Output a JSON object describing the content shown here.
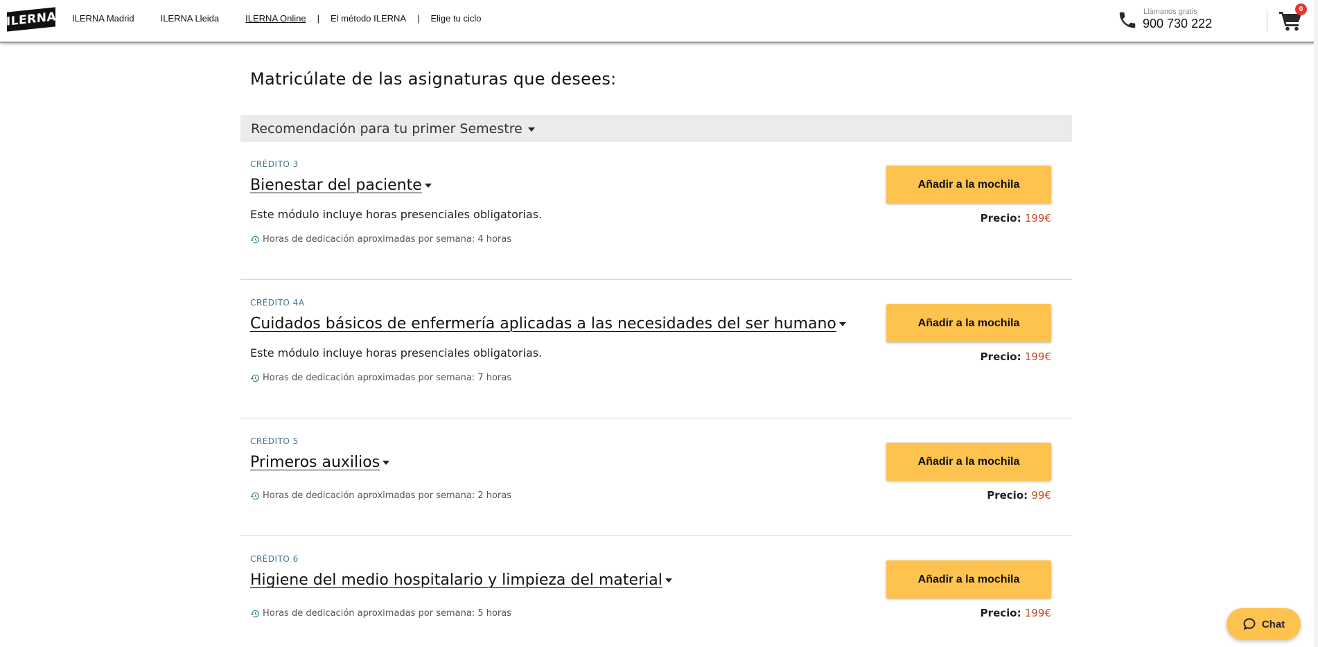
{
  "header": {
    "logo": "ILERNA",
    "nav": [
      {
        "label": "ILERNA Madrid"
      },
      {
        "label": "ILERNA Lleida"
      },
      {
        "label": "ILERNA Online"
      },
      {
        "label": "El método ILERNA"
      },
      {
        "label": "Elige tu ciclo"
      }
    ],
    "separator": "|",
    "phone_label": "Llámanos gratis",
    "phone_number": "900 730 222",
    "cart_count": "0"
  },
  "main": {
    "title": "Matricúlate de las asignaturas que desees:",
    "semester_label": "Recomendación para tu primer Semestre",
    "add_label": "Añadir a la mochila",
    "price_label": "Precio:",
    "courses": [
      {
        "credit": "CRÉDITO 3",
        "title": "Bienestar del paciente",
        "note": "Este módulo incluye horas presenciales obligatorias.",
        "hours": "Horas de dedicación aproximadas por semana: 4 horas",
        "price": "199€"
      },
      {
        "credit": "CRÉDITO 4A",
        "title": "Cuidados básicos de enfermería aplicadas a las necesidades del ser humano",
        "note": "Este módulo incluye horas presenciales obligatorias.",
        "hours": "Horas de dedicación aproximadas por semana: 7 horas",
        "price": "199€"
      },
      {
        "credit": "CRÉDITO 5",
        "title": "Primeros auxilios",
        "note": "",
        "hours": "Horas de dedicación aproximadas por semana: 2 horas",
        "price": "99€"
      },
      {
        "credit": "CRÉDITO 6",
        "title": "Higiene del medio hospitalario y limpieza del material",
        "note": "",
        "hours": "Horas de dedicación aproximadas por semana: 5 horas",
        "price": "199€"
      }
    ]
  },
  "chat": {
    "label": "Chat"
  },
  "icons": [
    "phone-icon",
    "cart-icon",
    "caret-down-icon",
    "history-icon",
    "chat-bubble-icon"
  ],
  "colors": {
    "accent": "#fec34f",
    "price": "#c14b26",
    "credit": "#3d7a8a",
    "badge": "#e8382e"
  }
}
